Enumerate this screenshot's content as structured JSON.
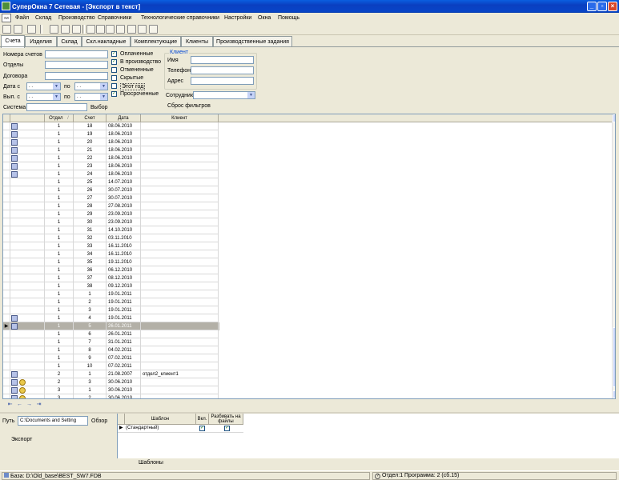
{
  "window": {
    "title": "СуперОкна 7 Сетевая - [Экспорт в текст]"
  },
  "menu": {
    "mdi_icon_label": "sw",
    "items": [
      "Файл",
      "Склад",
      "Производство",
      "Справочники",
      "Технологические справочники",
      "Настройки",
      "Окна",
      "Помощь"
    ]
  },
  "tabs": [
    "Счета",
    "Изделия",
    "Склад",
    "Скл.накладные",
    "Комплектующие",
    "Клиенты",
    "Производственные задания"
  ],
  "active_tab": "Счета",
  "filters": {
    "labels": {
      "invoice_numbers": "Номера счетов",
      "departments": "Отделы",
      "contract": "Договора",
      "date_from": "Дата с",
      "issued_from": "Вып. с",
      "to": "по",
      "system": "Система",
      "choose": "Выбор"
    },
    "date_placeholder": ". .",
    "checkboxes": [
      {
        "label": "Оплаченные",
        "checked": true
      },
      {
        "label": "В производство",
        "checked": true
      },
      {
        "label": "Отмененные",
        "checked": false
      },
      {
        "label": "Скрытые",
        "checked": false
      },
      {
        "label": "Этот год",
        "checked": false
      },
      {
        "label": "Просроченные",
        "checked": true
      }
    ],
    "client_group": {
      "title": "Клиент",
      "name": "Имя",
      "phone": "Телефон",
      "address": "Адрес"
    },
    "employee_label": "Сотрудник",
    "reset_label": "Сброс фильтров"
  },
  "grid": {
    "columns": [
      "Отдел",
      "Счет",
      "Дата",
      "Клиент"
    ],
    "sort_indicator": "/",
    "rows": [
      {
        "dept": "1",
        "inv": "18",
        "date": "08.06.2010",
        "client": "",
        "icons": "pin"
      },
      {
        "dept": "1",
        "inv": "19",
        "date": "18.06.2010",
        "client": "",
        "icons": "pin"
      },
      {
        "dept": "1",
        "inv": "20",
        "date": "18.06.2010",
        "client": "",
        "icons": "pin"
      },
      {
        "dept": "1",
        "inv": "21",
        "date": "18.06.2010",
        "client": "",
        "icons": "pin"
      },
      {
        "dept": "1",
        "inv": "22",
        "date": "18.06.2010",
        "client": "",
        "icons": "pin"
      },
      {
        "dept": "1",
        "inv": "23",
        "date": "18.06.2010",
        "client": "",
        "icons": "pin"
      },
      {
        "dept": "1",
        "inv": "24",
        "date": "18.06.2010",
        "client": "",
        "icons": "pin"
      },
      {
        "dept": "1",
        "inv": "25",
        "date": "14.07.2010",
        "client": "",
        "icons": ""
      },
      {
        "dept": "1",
        "inv": "26",
        "date": "30.07.2010",
        "client": "",
        "icons": ""
      },
      {
        "dept": "1",
        "inv": "27",
        "date": "30.07.2010",
        "client": "",
        "icons": ""
      },
      {
        "dept": "1",
        "inv": "28",
        "date": "27.08.2010",
        "client": "",
        "icons": ""
      },
      {
        "dept": "1",
        "inv": "29",
        "date": "23.09.2010",
        "client": "",
        "icons": ""
      },
      {
        "dept": "1",
        "inv": "30",
        "date": "23.09.2010",
        "client": "",
        "icons": ""
      },
      {
        "dept": "1",
        "inv": "31",
        "date": "14.10.2010",
        "client": "",
        "icons": ""
      },
      {
        "dept": "1",
        "inv": "32",
        "date": "03.11.2010",
        "client": "",
        "icons": ""
      },
      {
        "dept": "1",
        "inv": "33",
        "date": "16.11.2010",
        "client": "",
        "icons": ""
      },
      {
        "dept": "1",
        "inv": "34",
        "date": "16.11.2010",
        "client": "",
        "icons": ""
      },
      {
        "dept": "1",
        "inv": "35",
        "date": "19.11.2010",
        "client": "",
        "icons": ""
      },
      {
        "dept": "1",
        "inv": "36",
        "date": "06.12.2010",
        "client": "",
        "icons": ""
      },
      {
        "dept": "1",
        "inv": "37",
        "date": "08.12.2010",
        "client": "",
        "icons": ""
      },
      {
        "dept": "1",
        "inv": "38",
        "date": "09.12.2010",
        "client": "",
        "icons": ""
      },
      {
        "dept": "1",
        "inv": "1",
        "date": "19.01.2011",
        "client": "",
        "icons": ""
      },
      {
        "dept": "1",
        "inv": "2",
        "date": "19.01.2011",
        "client": "",
        "icons": ""
      },
      {
        "dept": "1",
        "inv": "3",
        "date": "19.01.2011",
        "client": "",
        "icons": ""
      },
      {
        "dept": "1",
        "inv": "4",
        "date": "19.01.2011",
        "client": "",
        "icons": "pin"
      },
      {
        "dept": "1",
        "inv": "5",
        "date": "26.01.2011",
        "client": "",
        "icons": "pin",
        "selected": true
      },
      {
        "dept": "1",
        "inv": "6",
        "date": "26.01.2011",
        "client": "",
        "icons": ""
      },
      {
        "dept": "1",
        "inv": "7",
        "date": "31.01.2011",
        "client": "",
        "icons": ""
      },
      {
        "dept": "1",
        "inv": "8",
        "date": "04.02.2011",
        "client": "",
        "icons": ""
      },
      {
        "dept": "1",
        "inv": "9",
        "date": "07.02.2011",
        "client": "",
        "icons": ""
      },
      {
        "dept": "1",
        "inv": "10",
        "date": "07.02.2011",
        "client": "",
        "icons": ""
      },
      {
        "dept": "2",
        "inv": "1",
        "date": "21.08.2007",
        "client": "отдел2_клиент1",
        "icons": "pin"
      },
      {
        "dept": "2",
        "inv": "3",
        "date": "30.06.2010",
        "client": "",
        "icons": "pin+coin"
      },
      {
        "dept": "3",
        "inv": "1",
        "date": "30.06.2010",
        "client": "",
        "icons": "pin+coin"
      },
      {
        "dept": "3",
        "inv": "2",
        "date": "30.06.2010",
        "client": "",
        "icons": "pin+coin"
      }
    ]
  },
  "export": {
    "path_label": "Путь",
    "path_value": "C:\\Documents and Setting",
    "browse_label": "Обзор",
    "export_label": "Экспорт",
    "templates_title": "Шаблоны",
    "template_columns": [
      "Шаблон",
      "Вкл.",
      "Разбивать на файлы"
    ],
    "template_rows": [
      {
        "name": "(Стандартный)",
        "enabled": true,
        "split": true
      }
    ]
  },
  "status": {
    "db": "База: D:\\Old_base\\BEST_SW7.FDB",
    "info": "Отдел:1 Программа: 2 (сб.15)"
  },
  "colors": {
    "titlebar": "#0a4fd8",
    "selected_row": "#b3b0a7",
    "window_bg": "#ece9d8"
  }
}
